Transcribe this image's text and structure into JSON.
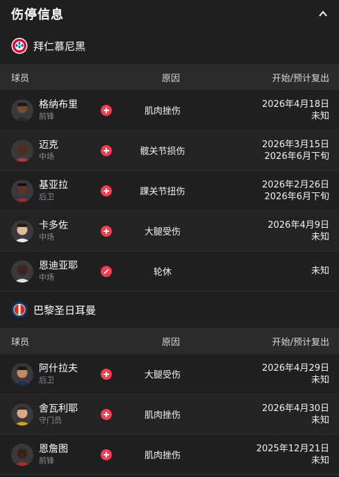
{
  "header": {
    "title": "伤停信息"
  },
  "teams": [
    {
      "name": "拜仁慕尼黑",
      "logo_icon": "bayern-logo-icon",
      "columns": {
        "player": "球员",
        "reason": "原因",
        "dates": "开始/预计复出"
      },
      "players": [
        {
          "name": "格纳布里",
          "position": "前锋",
          "status_icon": "injury-plus-icon",
          "reason": "肌肉挫伤",
          "start": "2026年4月18日",
          "return": "未知"
        },
        {
          "name": "迈克",
          "position": "中场",
          "status_icon": "injury-plus-icon",
          "reason": "髋关节损伤",
          "start": "2026年3月15日",
          "return": "2026年6月下旬"
        },
        {
          "name": "基亚拉",
          "position": "后卫",
          "status_icon": "injury-plus-icon",
          "reason": "踝关节扭伤",
          "start": "2026年2月26日",
          "return": "2026年6月下旬"
        },
        {
          "name": "卡多佐",
          "position": "中场",
          "status_icon": "injury-plus-icon",
          "reason": "大腿受伤",
          "start": "2026年4月9日",
          "return": "未知"
        },
        {
          "name": "恩迪亚耶",
          "position": "中场",
          "status_icon": "rotation-slash-icon",
          "reason": "轮休",
          "start": "",
          "return": "未知"
        }
      ]
    },
    {
      "name": "巴黎圣日耳曼",
      "logo_icon": "psg-logo-icon",
      "columns": {
        "player": "球员",
        "reason": "原因",
        "dates": "开始/预计复出"
      },
      "players": [
        {
          "name": "阿什拉夫",
          "position": "后卫",
          "status_icon": "injury-plus-icon",
          "reason": "大腿受伤",
          "start": "2026年4月29日",
          "return": "未知"
        },
        {
          "name": "舍瓦利耶",
          "position": "守门员",
          "status_icon": "injury-plus-icon",
          "reason": "肌肉挫伤",
          "start": "2026年4月30日",
          "return": "未知"
        },
        {
          "name": "恩詹图",
          "position": "前锋",
          "status_icon": "injury-plus-icon",
          "reason": "肌肉挫伤",
          "start": "2025年12月21日",
          "return": "未知"
        }
      ]
    }
  ],
  "colors": {
    "background": "#1f1f21",
    "column_bar": "#2b2b2e",
    "status_red": "#ff3b4e",
    "muted_text": "#8e8e93"
  }
}
